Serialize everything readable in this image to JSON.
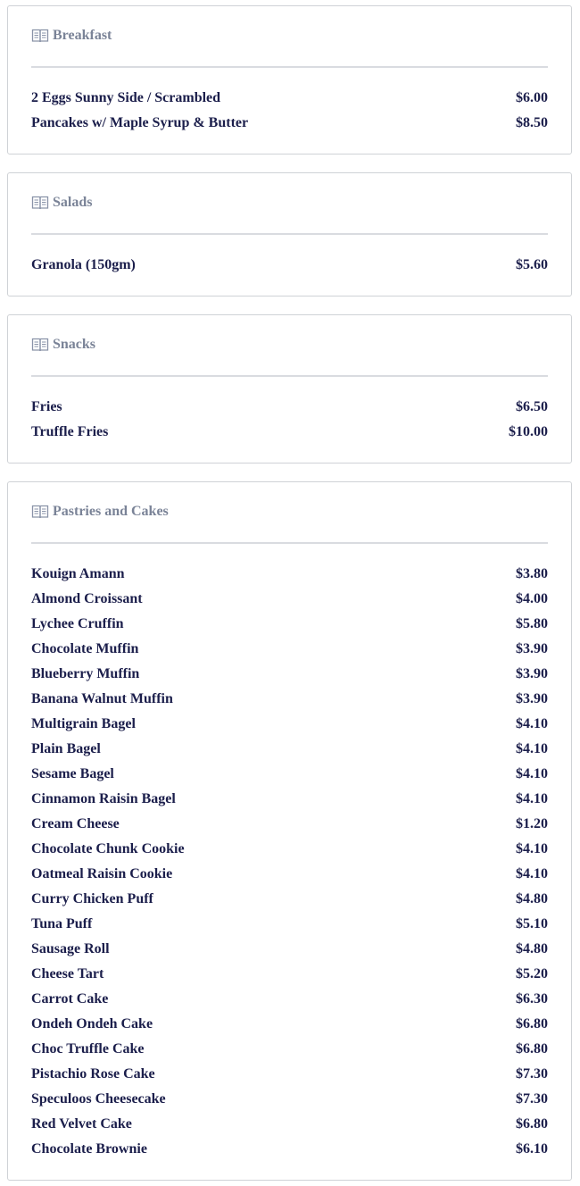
{
  "sections": [
    {
      "title": "Breakfast",
      "icon": "book-icon",
      "items": [
        {
          "name": "2 Eggs Sunny Side / Scrambled",
          "price": "$6.00"
        },
        {
          "name": "Pancakes w/ Maple Syrup & Butter",
          "price": "$8.50"
        }
      ]
    },
    {
      "title": "Salads",
      "icon": "book-icon",
      "items": [
        {
          "name": "Granola (150gm)",
          "price": "$5.60"
        }
      ]
    },
    {
      "title": "Snacks",
      "icon": "book-icon",
      "items": [
        {
          "name": "Fries",
          "price": "$6.50"
        },
        {
          "name": "Truffle Fries",
          "price": "$10.00"
        }
      ]
    },
    {
      "title": "Pastries and Cakes",
      "icon": "book-icon",
      "items": [
        {
          "name": "Kouign Amann",
          "price": "$3.80"
        },
        {
          "name": "Almond Croissant",
          "price": "$4.00"
        },
        {
          "name": "Lychee Cruffin",
          "price": "$5.80"
        },
        {
          "name": "Chocolate Muffin",
          "price": "$3.90"
        },
        {
          "name": "Blueberry Muffin",
          "price": "$3.90"
        },
        {
          "name": "Banana Walnut Muffin",
          "price": "$3.90"
        },
        {
          "name": "Multigrain Bagel",
          "price": "$4.10"
        },
        {
          "name": "Plain Bagel",
          "price": "$4.10"
        },
        {
          "name": "Sesame Bagel",
          "price": "$4.10"
        },
        {
          "name": "Cinnamon Raisin Bagel",
          "price": "$4.10"
        },
        {
          "name": "Cream Cheese",
          "price": "$1.20"
        },
        {
          "name": "Chocolate Chunk Cookie",
          "price": "$4.10"
        },
        {
          "name": "Oatmeal Raisin Cookie",
          "price": "$4.10"
        },
        {
          "name": "Curry Chicken Puff",
          "price": "$4.80"
        },
        {
          "name": "Tuna Puff",
          "price": "$5.10"
        },
        {
          "name": "Sausage Roll",
          "price": "$4.80"
        },
        {
          "name": "Cheese Tart",
          "price": "$5.20"
        },
        {
          "name": "Carrot Cake",
          "price": "$6.30"
        },
        {
          "name": "Ondeh Ondeh Cake",
          "price": "$6.80"
        },
        {
          "name": "Choc Truffle Cake",
          "price": "$6.80"
        },
        {
          "name": "Pistachio Rose Cake",
          "price": "$7.30"
        },
        {
          "name": "Speculoos Cheesecake",
          "price": "$7.30"
        },
        {
          "name": "Red Velvet Cake",
          "price": "$6.80"
        },
        {
          "name": "Chocolate Brownie",
          "price": "$6.10"
        }
      ]
    }
  ]
}
